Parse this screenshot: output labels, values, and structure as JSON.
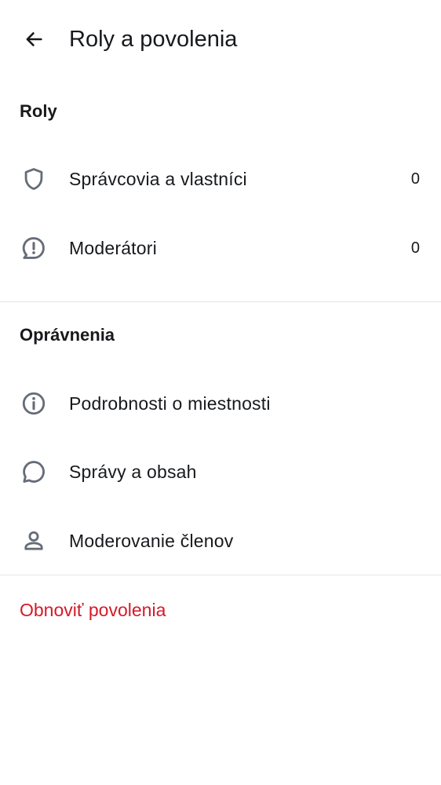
{
  "header": {
    "title": "Roly a povolenia",
    "back_icon": "arrow-left-icon"
  },
  "roles_section": {
    "title": "Roly",
    "items": [
      {
        "label": "Správcovia a vlastníci",
        "count": "0",
        "icon": "shield-icon"
      },
      {
        "label": "Moderátori",
        "count": "0",
        "icon": "report-bubble-icon"
      }
    ]
  },
  "permissions_section": {
    "title": "Oprávnenia",
    "items": [
      {
        "label": "Podrobnosti o miestnosti",
        "icon": "info-icon"
      },
      {
        "label": "Správy a obsah",
        "icon": "chat-bubble-icon"
      },
      {
        "label": "Moderovanie členov",
        "icon": "user-icon"
      }
    ]
  },
  "reset": {
    "label": "Obnoviť povolenia"
  },
  "colors": {
    "text": "#17191c",
    "icon": "#656d77",
    "divider": "#e3e5e8",
    "danger": "#d51928"
  }
}
